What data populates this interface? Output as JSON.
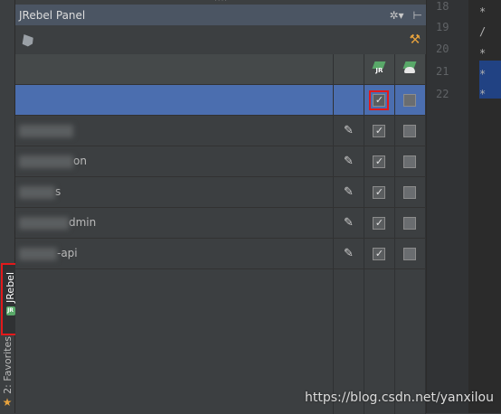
{
  "panel": {
    "title": "JRebel Panel",
    "settings_icon": "gear-icon",
    "pin_icon": "pin-icon"
  },
  "toolbar": {
    "left_icon": "rocket-icon",
    "right_icon": "settings-wrench-icon"
  },
  "table": {
    "header_icons": [
      "jrebel-agent-icon",
      "jrebel-remote-icon"
    ],
    "header_agent_label": "JR",
    "rows": [
      {
        "name": "",
        "selected": true,
        "editable": false,
        "jrebel": true,
        "remote": false
      },
      {
        "name": "",
        "selected": false,
        "editable": true,
        "jrebel": true,
        "remote": false
      },
      {
        "name": "on",
        "selected": false,
        "editable": true,
        "jrebel": true,
        "remote": false
      },
      {
        "name": "s",
        "selected": false,
        "editable": true,
        "jrebel": true,
        "remote": false
      },
      {
        "name": "dmin",
        "selected": false,
        "editable": true,
        "jrebel": true,
        "remote": false
      },
      {
        "name": "-api",
        "selected": false,
        "editable": true,
        "jrebel": true,
        "remote": false
      }
    ]
  },
  "side_tabs": {
    "jrebel": "JRebel",
    "jrebel_badge": "JR",
    "favorites": "2: Favorites"
  },
  "editor": {
    "line_numbers": [
      "18",
      "19",
      "20",
      "21",
      "22"
    ],
    "code_snippets": [
      "*",
      "/",
      "*",
      "*",
      "*"
    ]
  },
  "watermark": "https://blog.csdn.net/yanxilou",
  "colors": {
    "selection": "#4b6eaf",
    "highlight_box": "#e3191b",
    "jrebel_green": "#59a869",
    "title_bar": "#4b5563"
  }
}
